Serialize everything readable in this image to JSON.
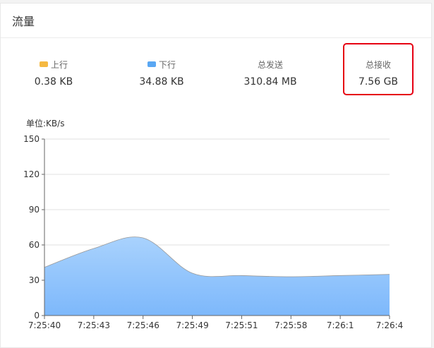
{
  "header": {
    "title": "流量"
  },
  "stats": [
    {
      "label": "上行",
      "value": "0.38 KB",
      "swatch": "#f5b942"
    },
    {
      "label": "下行",
      "value": "34.88 KB",
      "swatch": "#5aa7f3"
    },
    {
      "label": "总发送",
      "value": "310.84 MB"
    },
    {
      "label": "总接收",
      "value": "7.56 GB"
    }
  ],
  "highlight_color": "#e60012",
  "chart_data": {
    "type": "area",
    "unit_label": "单位:KB/s",
    "x": [
      "7:25:40",
      "7:25:43",
      "7:25:46",
      "7:25:49",
      "7:25:51",
      "7:25:58",
      "7:26:1",
      "7:26:4"
    ],
    "series": [
      {
        "values": [
          41,
          57,
          66,
          36,
          34,
          33,
          34,
          35
        ],
        "color": "#7db8fb"
      }
    ],
    "yticks": [
      0,
      30,
      60,
      90,
      120,
      150
    ],
    "ylim": [
      0,
      150
    ],
    "grid": true
  }
}
